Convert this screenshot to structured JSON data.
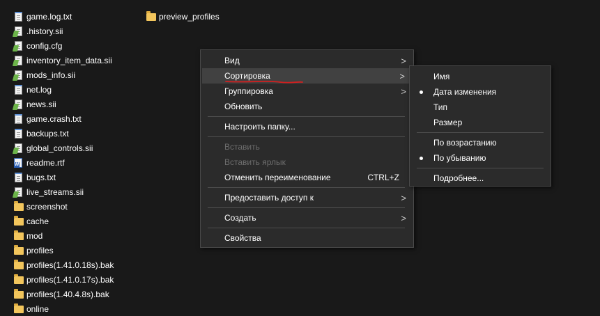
{
  "files": [
    {
      "name": "game.log.txt",
      "icon": "text-file-icon"
    },
    {
      "name": ".history.sii",
      "icon": "notepadpp-file-icon"
    },
    {
      "name": "config.cfg",
      "icon": "notepadpp-file-icon"
    },
    {
      "name": "inventory_item_data.sii",
      "icon": "notepadpp-file-icon"
    },
    {
      "name": "mods_info.sii",
      "icon": "notepadpp-file-icon"
    },
    {
      "name": "net.log",
      "icon": "text-file-icon"
    },
    {
      "name": "news.sii",
      "icon": "notepadpp-file-icon"
    },
    {
      "name": "game.crash.txt",
      "icon": "text-file-icon"
    },
    {
      "name": "backups.txt",
      "icon": "text-file-icon"
    },
    {
      "name": "global_controls.sii",
      "icon": "notepadpp-file-icon"
    },
    {
      "name": "readme.rtf",
      "icon": "wordpad-file-icon"
    },
    {
      "name": "bugs.txt",
      "icon": "text-file-icon"
    },
    {
      "name": "live_streams.sii",
      "icon": "notepadpp-file-icon"
    },
    {
      "name": "screenshot",
      "icon": "folder-icon"
    },
    {
      "name": "cache",
      "icon": "folder-icon"
    },
    {
      "name": "mod",
      "icon": "folder-icon"
    },
    {
      "name": "profiles",
      "icon": "folder-icon"
    },
    {
      "name": "profiles(1.41.0.18s).bak",
      "icon": "folder-icon"
    },
    {
      "name": "profiles(1.41.0.17s).bak",
      "icon": "folder-icon"
    },
    {
      "name": "profiles(1.40.4.8s).bak",
      "icon": "folder-icon"
    },
    {
      "name": "online",
      "icon": "folder-icon"
    }
  ],
  "preview_folder": {
    "name": "preview_profiles",
    "icon": "folder-icon"
  },
  "context_menu": {
    "view": "Вид",
    "sort": "Сортировка",
    "group": "Группировка",
    "refresh": "Обновить",
    "customize_folder": "Настроить папку...",
    "paste": "Вставить",
    "paste_shortcut": "Вставить ярлык",
    "undo_rename": "Отменить переименование",
    "undo_rename_shortcut": "CTRL+Z",
    "give_access": "Предоставить доступ к",
    "new": "Создать",
    "properties": "Свойства",
    "chevron": ">"
  },
  "sort_menu": {
    "name": "Имя",
    "date_modified": "Дата изменения",
    "type": "Тип",
    "size": "Размер",
    "ascending": "По возрастанию",
    "descending": "По убыванию",
    "more": "Подробнее..."
  },
  "colors": {
    "background": "#191919",
    "menu_background": "#2b2b2b",
    "highlight": "#414141",
    "annotation": "#d02020"
  }
}
